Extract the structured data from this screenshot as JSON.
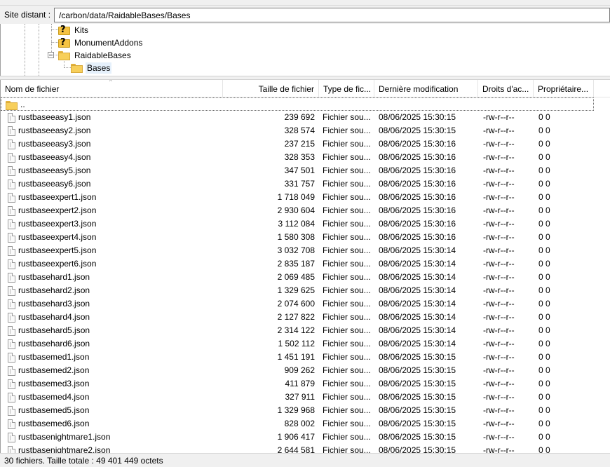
{
  "path": {
    "label": "Site distant :",
    "value": "/carbon/data/RaidableBases/Bases"
  },
  "tree": {
    "items": [
      {
        "label": "Kits",
        "icon": "unknown-folder-icon"
      },
      {
        "label": "MonumentAddons",
        "icon": "unknown-folder-icon"
      },
      {
        "label": "RaidableBases",
        "icon": "folder-icon"
      },
      {
        "label": "Bases",
        "icon": "folder-icon"
      }
    ]
  },
  "list": {
    "columns": {
      "name": "Nom de fichier",
      "size": "Taille de fichier",
      "type": "Type de fic...",
      "modified": "Dernière modification",
      "perms": "Droits d'ac...",
      "owner": "Propriétaire..."
    },
    "parent_label": "..",
    "rows": [
      {
        "name": "rustbaseeasy1.json",
        "size": "239 692",
        "type": "Fichier sou...",
        "modified": "08/06/2025 15:30:15",
        "perms": "-rw-r--r--",
        "owner": "0 0"
      },
      {
        "name": "rustbaseeasy2.json",
        "size": "328 574",
        "type": "Fichier sou...",
        "modified": "08/06/2025 15:30:15",
        "perms": "-rw-r--r--",
        "owner": "0 0"
      },
      {
        "name": "rustbaseeasy3.json",
        "size": "237 215",
        "type": "Fichier sou...",
        "modified": "08/06/2025 15:30:16",
        "perms": "-rw-r--r--",
        "owner": "0 0"
      },
      {
        "name": "rustbaseeasy4.json",
        "size": "328 353",
        "type": "Fichier sou...",
        "modified": "08/06/2025 15:30:16",
        "perms": "-rw-r--r--",
        "owner": "0 0"
      },
      {
        "name": "rustbaseeasy5.json",
        "size": "347 501",
        "type": "Fichier sou...",
        "modified": "08/06/2025 15:30:16",
        "perms": "-rw-r--r--",
        "owner": "0 0"
      },
      {
        "name": "rustbaseeasy6.json",
        "size": "331 757",
        "type": "Fichier sou...",
        "modified": "08/06/2025 15:30:16",
        "perms": "-rw-r--r--",
        "owner": "0 0"
      },
      {
        "name": "rustbaseexpert1.json",
        "size": "1 718 049",
        "type": "Fichier sou...",
        "modified": "08/06/2025 15:30:16",
        "perms": "-rw-r--r--",
        "owner": "0 0"
      },
      {
        "name": "rustbaseexpert2.json",
        "size": "2 930 604",
        "type": "Fichier sou...",
        "modified": "08/06/2025 15:30:16",
        "perms": "-rw-r--r--",
        "owner": "0 0"
      },
      {
        "name": "rustbaseexpert3.json",
        "size": "3 112 084",
        "type": "Fichier sou...",
        "modified": "08/06/2025 15:30:16",
        "perms": "-rw-r--r--",
        "owner": "0 0"
      },
      {
        "name": "rustbaseexpert4.json",
        "size": "1 580 308",
        "type": "Fichier sou...",
        "modified": "08/06/2025 15:30:16",
        "perms": "-rw-r--r--",
        "owner": "0 0"
      },
      {
        "name": "rustbaseexpert5.json",
        "size": "3 032 708",
        "type": "Fichier sou...",
        "modified": "08/06/2025 15:30:14",
        "perms": "-rw-r--r--",
        "owner": "0 0"
      },
      {
        "name": "rustbaseexpert6.json",
        "size": "2 835 187",
        "type": "Fichier sou...",
        "modified": "08/06/2025 15:30:14",
        "perms": "-rw-r--r--",
        "owner": "0 0"
      },
      {
        "name": "rustbasehard1.json",
        "size": "2 069 485",
        "type": "Fichier sou...",
        "modified": "08/06/2025 15:30:14",
        "perms": "-rw-r--r--",
        "owner": "0 0"
      },
      {
        "name": "rustbasehard2.json",
        "size": "1 329 625",
        "type": "Fichier sou...",
        "modified": "08/06/2025 15:30:14",
        "perms": "-rw-r--r--",
        "owner": "0 0"
      },
      {
        "name": "rustbasehard3.json",
        "size": "2 074 600",
        "type": "Fichier sou...",
        "modified": "08/06/2025 15:30:14",
        "perms": "-rw-r--r--",
        "owner": "0 0"
      },
      {
        "name": "rustbasehard4.json",
        "size": "2 127 822",
        "type": "Fichier sou...",
        "modified": "08/06/2025 15:30:14",
        "perms": "-rw-r--r--",
        "owner": "0 0"
      },
      {
        "name": "rustbasehard5.json",
        "size": "2 314 122",
        "type": "Fichier sou...",
        "modified": "08/06/2025 15:30:14",
        "perms": "-rw-r--r--",
        "owner": "0 0"
      },
      {
        "name": "rustbasehard6.json",
        "size": "1 502 112",
        "type": "Fichier sou...",
        "modified": "08/06/2025 15:30:14",
        "perms": "-rw-r--r--",
        "owner": "0 0"
      },
      {
        "name": "rustbasemed1.json",
        "size": "1 451 191",
        "type": "Fichier sou...",
        "modified": "08/06/2025 15:30:15",
        "perms": "-rw-r--r--",
        "owner": "0 0"
      },
      {
        "name": "rustbasemed2.json",
        "size": "909 262",
        "type": "Fichier sou...",
        "modified": "08/06/2025 15:30:15",
        "perms": "-rw-r--r--",
        "owner": "0 0"
      },
      {
        "name": "rustbasemed3.json",
        "size": "411 879",
        "type": "Fichier sou...",
        "modified": "08/06/2025 15:30:15",
        "perms": "-rw-r--r--",
        "owner": "0 0"
      },
      {
        "name": "rustbasemed4.json",
        "size": "327 911",
        "type": "Fichier sou...",
        "modified": "08/06/2025 15:30:15",
        "perms": "-rw-r--r--",
        "owner": "0 0"
      },
      {
        "name": "rustbasemed5.json",
        "size": "1 329 968",
        "type": "Fichier sou...",
        "modified": "08/06/2025 15:30:15",
        "perms": "-rw-r--r--",
        "owner": "0 0"
      },
      {
        "name": "rustbasemed6.json",
        "size": "828 002",
        "type": "Fichier sou...",
        "modified": "08/06/2025 15:30:15",
        "perms": "-rw-r--r--",
        "owner": "0 0"
      },
      {
        "name": "rustbasenightmare1.json",
        "size": "1 906 417",
        "type": "Fichier sou...",
        "modified": "08/06/2025 15:30:15",
        "perms": "-rw-r--r--",
        "owner": "0 0"
      },
      {
        "name": "rustbasenightmare2.json",
        "size": "2 644 581",
        "type": "Fichier sou...",
        "modified": "08/06/2025 15:30:15",
        "perms": "-rw-r--r--",
        "owner": "0 0"
      }
    ]
  },
  "status": {
    "text": "30 fichiers. Taille totale : 49 401 449 octets"
  }
}
